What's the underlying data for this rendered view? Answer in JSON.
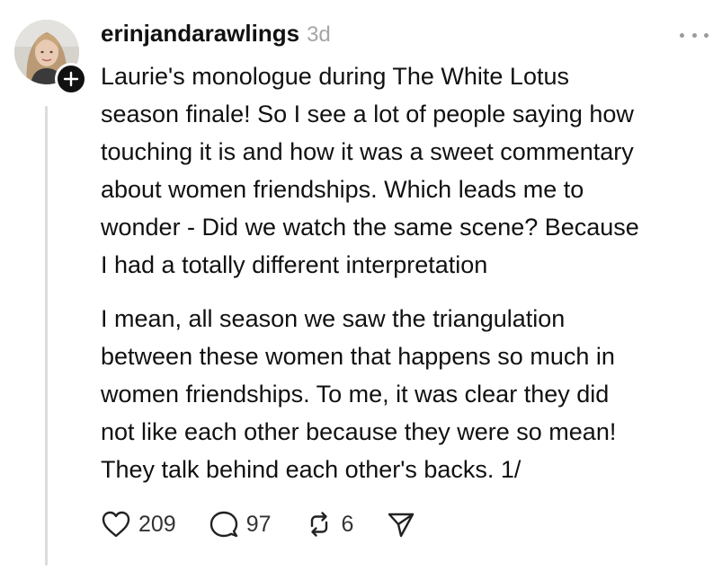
{
  "post": {
    "author": {
      "username": "erinjandarawlings",
      "avatar_icon": "profile-photo",
      "follow_icon": "plus-icon"
    },
    "timestamp": "3d",
    "more_icon": "more-horizontal-icon",
    "paragraphs": [
      "Laurie's monologue during The White Lotus\nseason finale!  So I see a lot of people saying how\ntouching it is and how it was a sweet commentary\nabout women friendships.  Which leads me to\nwonder - Did we watch the same scene? Because\nI had a totally different interpretation",
      "I mean, all season we saw the triangulation\nbetween these women that happens so much in\nwomen friendships.  To me, it was clear they did\nnot like each other because they were so mean!\nThey talk behind each other's backs. 1/"
    ],
    "actions": {
      "like": {
        "icon": "heart-icon",
        "count": "209"
      },
      "reply": {
        "icon": "comment-icon",
        "count": "97"
      },
      "repost": {
        "icon": "repost-icon",
        "count": "6"
      },
      "share": {
        "icon": "send-icon"
      }
    }
  },
  "colors": {
    "text": "#111111",
    "muted": "#a6a6a6",
    "thread_line": "#dcdcdc",
    "background": "#ffffff"
  }
}
